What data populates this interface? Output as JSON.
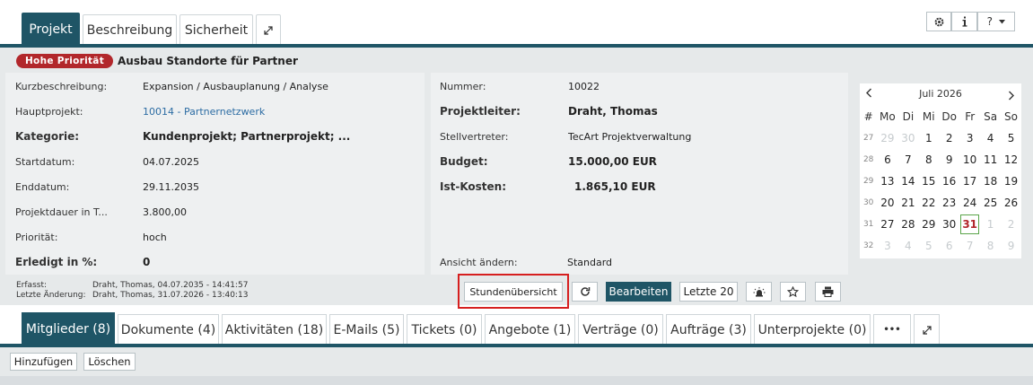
{
  "top_tabs": [
    {
      "label": "Projekt"
    },
    {
      "label": "Beschreibung"
    },
    {
      "label": "Sicherheit"
    }
  ],
  "top_right": {
    "help_label": "?"
  },
  "header": {
    "priority_badge": "Hohe Priorität",
    "title": "Ausbau Standorte für Partner"
  },
  "left_fields": [
    {
      "label": "Kurzbeschreibung:",
      "value": "Expansion / Ausbauplanung / Analyse"
    },
    {
      "label": "Hauptprojekt:",
      "value": "10014 - Partnernetzwerk"
    },
    {
      "label": "Kategorie:",
      "value": "Kundenprojekt; Partnerprojekt; ..."
    },
    {
      "label": "Startdatum:",
      "value": "04.07.2025"
    },
    {
      "label": "Enddatum:",
      "value": "29.11.2035"
    },
    {
      "label": "Projektdauer in T...",
      "value": "3.800,00"
    },
    {
      "label": "Priorität:",
      "value": "hoch"
    },
    {
      "label": "Erledigt in %:",
      "value": "0"
    }
  ],
  "right_fields": [
    {
      "label": "Nummer:",
      "value": "10022"
    },
    {
      "label": "Projektleiter:",
      "value": "Draht, Thomas"
    },
    {
      "label": "Stellvertreter:",
      "value": "TecArt Projektverwaltung"
    },
    {
      "label": "Budget:",
      "value": "15.000,00 EUR"
    },
    {
      "label": "Ist-Kosten:",
      "value": "1.865,10 EUR"
    },
    {
      "label": "Ansicht ändern:",
      "value": "Standard"
    }
  ],
  "meta": {
    "erfasst_label": "Erfasst:",
    "erfasst_value": "Draht, Thomas, 04.07.2035 - 14:41:57",
    "aenderung_label": "Letzte Änderung:",
    "aenderung_value": "Draht, Thomas, 31.07.2026 - 13:40:13"
  },
  "actions": {
    "stunden": "Stundenübersicht",
    "bearbeiten": "Bearbeiten",
    "letzte": "Letzte 20"
  },
  "calendar": {
    "month": "Juli 2026",
    "headers": [
      "#",
      "Mo",
      "Di",
      "Mi",
      "Do",
      "Fr",
      "Sa",
      "So"
    ],
    "weeks": [
      {
        "wk": "27",
        "days": [
          "29",
          "30",
          "1",
          "2",
          "3",
          "4",
          "5"
        ],
        "muted": [
          true,
          true,
          false,
          false,
          false,
          false,
          false
        ]
      },
      {
        "wk": "28",
        "days": [
          "6",
          "7",
          "8",
          "9",
          "10",
          "11",
          "12"
        ],
        "muted": [
          false,
          false,
          false,
          false,
          false,
          false,
          false
        ]
      },
      {
        "wk": "29",
        "days": [
          "13",
          "14",
          "15",
          "16",
          "17",
          "18",
          "19"
        ],
        "muted": [
          false,
          false,
          false,
          false,
          false,
          false,
          false
        ]
      },
      {
        "wk": "30",
        "days": [
          "20",
          "21",
          "22",
          "23",
          "24",
          "25",
          "26"
        ],
        "muted": [
          false,
          false,
          false,
          false,
          false,
          false,
          false
        ]
      },
      {
        "wk": "31",
        "days": [
          "27",
          "28",
          "29",
          "30",
          "31",
          "1",
          "2"
        ],
        "muted": [
          false,
          false,
          false,
          false,
          false,
          true,
          true
        ]
      },
      {
        "wk": "32",
        "days": [
          "3",
          "4",
          "5",
          "6",
          "7",
          "8",
          "9"
        ],
        "muted": [
          true,
          true,
          true,
          true,
          true,
          true,
          true
        ]
      }
    ],
    "today": "31"
  },
  "bottom_tabs": [
    {
      "label": "Mitglieder (8)"
    },
    {
      "label": "Dokumente (4)"
    },
    {
      "label": "Aktivitäten (18)"
    },
    {
      "label": "E-Mails (5)"
    },
    {
      "label": "Tickets (0)"
    },
    {
      "label": "Angebote (1)"
    },
    {
      "label": "Verträge (0)"
    },
    {
      "label": "Aufträge (3)"
    },
    {
      "label": "Unterprojekte (0)"
    }
  ],
  "bottom_more": "•••",
  "list_actions": {
    "add": "Hinzufügen",
    "delete": "Löschen"
  }
}
